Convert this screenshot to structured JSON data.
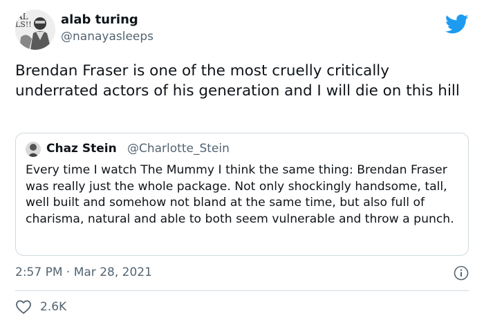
{
  "author": {
    "display_name": "alab turing",
    "handle": "@nanayasleeps"
  },
  "tweet": {
    "text": "Brendan Fraser is one of the most cruelly critically underrated actors of his generation and I will die on this hill"
  },
  "quoted_tweet": {
    "display_name": "Chaz Stein",
    "handle": "@Charlotte_Stein",
    "text": "Every time I watch The Mummy I think the same thing: Brendan Fraser was really just the whole package. Not only shockingly handsome, tall, well built and somehow not bland at the same time, but also full of charisma, natural and able to both seem vulnerable and throw a punch."
  },
  "meta": {
    "timestamp": "2:57 PM · Mar 28, 2021",
    "like_count": "2.6K"
  },
  "avatar": {
    "badge_lines": [
      "AL",
      "LS!!"
    ]
  },
  "colors": {
    "brand_blue": "#1d9bf0",
    "text_primary": "#0f1419",
    "text_secondary": "#536471",
    "border": "#cfd9de"
  },
  "icons": {
    "brand": "twitter-bird-icon",
    "info": "info-icon",
    "like": "heart-outline-icon"
  }
}
